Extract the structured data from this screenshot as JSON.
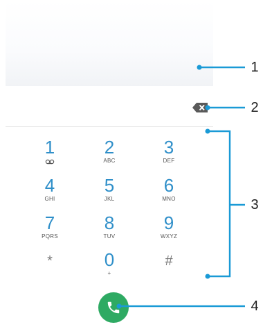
{
  "dialpad": {
    "keys": [
      {
        "digit": "1",
        "sub": "",
        "icon": "voicemail-icon"
      },
      {
        "digit": "2",
        "sub": "ABC"
      },
      {
        "digit": "3",
        "sub": "DEF"
      },
      {
        "digit": "4",
        "sub": "GHI"
      },
      {
        "digit": "5",
        "sub": "JKL"
      },
      {
        "digit": "6",
        "sub": "MNO"
      },
      {
        "digit": "7",
        "sub": "PQRS"
      },
      {
        "digit": "8",
        "sub": "TUV"
      },
      {
        "digit": "9",
        "sub": "WXYZ"
      },
      {
        "digit": "*",
        "sub": ""
      },
      {
        "digit": "0",
        "sub": "+"
      },
      {
        "digit": "#",
        "sub": ""
      }
    ]
  },
  "icons": {
    "backspace": "backspace-icon",
    "call": "phone-icon"
  },
  "callouts": [
    "1",
    "2",
    "3",
    "4"
  ],
  "colors": {
    "accent": "#2f8fc9",
    "call_button": "#2eaa63",
    "callout_line": "#1a9ad6"
  }
}
